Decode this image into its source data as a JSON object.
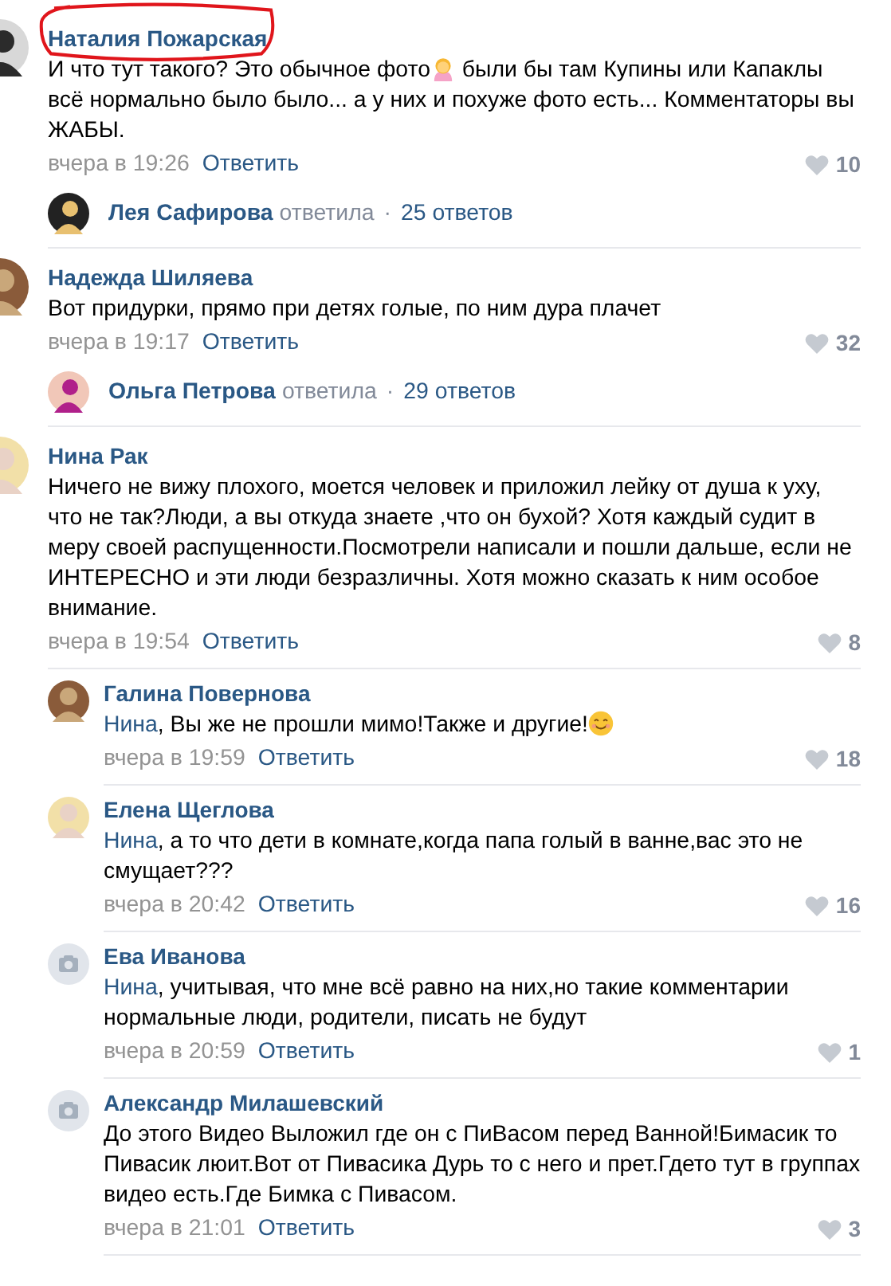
{
  "comments": [
    {
      "author": "Наталия Пожарская",
      "avatar": {
        "kind": "picture"
      },
      "circled": true,
      "segments": [
        {
          "kind": "text",
          "text": "И что тут такого? Это обычное фото"
        },
        {
          "kind": "gesture"
        },
        {
          "kind": "text",
          "text": " были бы там Купины или Капаклы всё нормально было было... а у них и похуже фото есть... Комментаторы вы ЖАБЫ."
        }
      ],
      "date": "вчера в 19:26",
      "reply_label": "Ответить",
      "likes": "10",
      "thread": {
        "author": "Лея Сафирова",
        "verb": "ответила",
        "separator": "·",
        "count": "25 ответов"
      }
    },
    {
      "author": "Надежда Шиляева",
      "avatar": {
        "kind": "picture"
      },
      "circled": false,
      "segments": [
        {
          "kind": "text",
          "text": "Вот придурки, прямо при детях голые, по ним дура плачет"
        }
      ],
      "date": "вчера в 19:17",
      "reply_label": "Ответить",
      "likes": "32",
      "thread": {
        "author": "Ольга Петрова",
        "verb": "ответила",
        "separator": "·",
        "count": "29 ответов"
      }
    },
    {
      "author": "Нина Рак",
      "avatar": {
        "kind": "picture"
      },
      "circled": false,
      "segments": [
        {
          "kind": "text",
          "text": "Ничего не вижу плохого, моется человек и приложил лейку от душа к уху, что не так?Люди, а вы откуда знаете ,что он бухой? Хотя каждый судит в меру своей распущенности.Посмотрели написали и пошли дальше, если не ИНТЕРЕСНО и эти люди безразличны. Хотя можно сказать к ним особое внимание."
        }
      ],
      "date": "вчера в 19:54",
      "reply_label": "Ответить",
      "likes": "8",
      "replies": [
        {
          "author": "Галина Повернова",
          "avatar": {
            "kind": "picture"
          },
          "segments": [
            {
              "kind": "mention",
              "text": "Нина"
            },
            {
              "kind": "text",
              "text": ", Вы же не прошли мимо!Также и другие!"
            },
            {
              "kind": "smiley"
            }
          ],
          "date": "вчера в 19:59",
          "reply_label": "Ответить",
          "likes": "18"
        },
        {
          "author": "Елена Щеглова",
          "avatar": {
            "kind": "picture"
          },
          "segments": [
            {
              "kind": "mention",
              "text": "Нина"
            },
            {
              "kind": "text",
              "text": ", а то что дети в комнате,когда папа голый в ванне,вас это не смущает???"
            }
          ],
          "date": "вчера в 20:42",
          "reply_label": "Ответить",
          "likes": "16"
        },
        {
          "author": "Ева Иванова",
          "avatar": {
            "kind": "placeholder"
          },
          "segments": [
            {
              "kind": "mention",
              "text": "Нина"
            },
            {
              "kind": "text",
              "text": ", учитывая, что мне всё равно на них,но такие комментарии нормальные люди, родители, писать не будут"
            }
          ],
          "date": "вчера в 20:59",
          "reply_label": "Ответить",
          "likes": "1"
        },
        {
          "author": "Александр Милашевский",
          "avatar": {
            "kind": "placeholder"
          },
          "segments": [
            {
              "kind": "text",
              "text": "До этого Видео Выложил где он с ПиВасом перед Ванной!Бимасик то Пивасик люит.Вот от Пивасика Дурь то с него и прет.Гдето тут в группах видео есть.Где Бимка с Пивасом."
            }
          ],
          "date": "вчера в 21:01",
          "reply_label": "Ответить",
          "likes": "3"
        }
      ]
    }
  ]
}
